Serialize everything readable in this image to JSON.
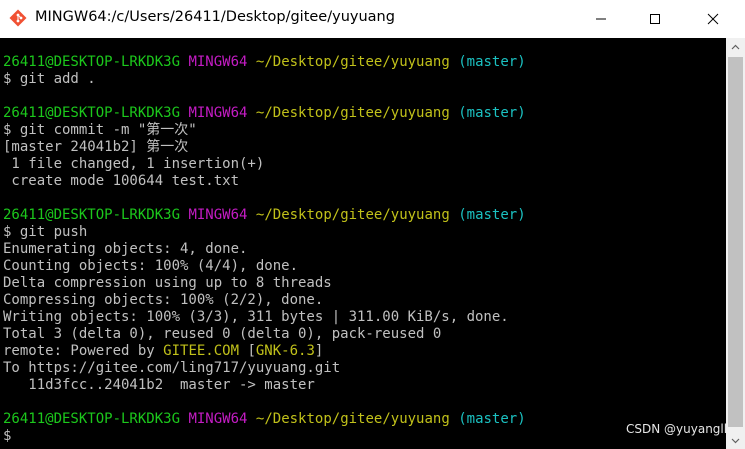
{
  "window": {
    "title": "MINGW64:/c/Users/26411/Desktop/gitee/yuyuang",
    "buttons": {
      "minimize": "minimize-icon",
      "maximize": "maximize-icon",
      "close": "close-icon"
    }
  },
  "terminal": {
    "prompt": {
      "user": "26411@DESKTOP-LRKDK3G",
      "env": "MINGW64",
      "path": "~/Desktop/gitee/yuyuang",
      "branch": "(master)"
    },
    "colors": {
      "green": "#1cc81c",
      "magenta": "#c41cc4",
      "yellow": "#c1c11a",
      "cyan": "#1bc1c1",
      "text": "#c0c0c0"
    },
    "line1": "$ git add .",
    "line2": "$ git commit -m \"第一次\"",
    "line3": "[master 24041b2] 第一次",
    "line4": " 1 file changed, 1 insertion(+)",
    "line5": " create mode 100644 test.txt",
    "line6": "$ git push",
    "line7": "Enumerating objects: 4, done.",
    "line8": "Counting objects: 100% (4/4), done.",
    "line9": "Delta compression using up to 8 threads",
    "line10": "Compressing objects: 100% (2/2), done.",
    "line11": "Writing objects: 100% (3/3), 311 bytes | 311.00 KiB/s, done.",
    "line12": "Total 3 (delta 0), reused 0 (delta 0), pack-reused 0",
    "remote_prefix": "remote: Powered by ",
    "remote_site": "GITEE.COM",
    "remote_open": " [",
    "remote_version": "GNK-6.3",
    "remote_close": "]",
    "line14": "To https://gitee.com/ling717/yuyuang.git",
    "line15": "   11d3fcc..24041b2  master -> master",
    "cursor_line": "$"
  },
  "watermark": "CSDN @yuyangll"
}
